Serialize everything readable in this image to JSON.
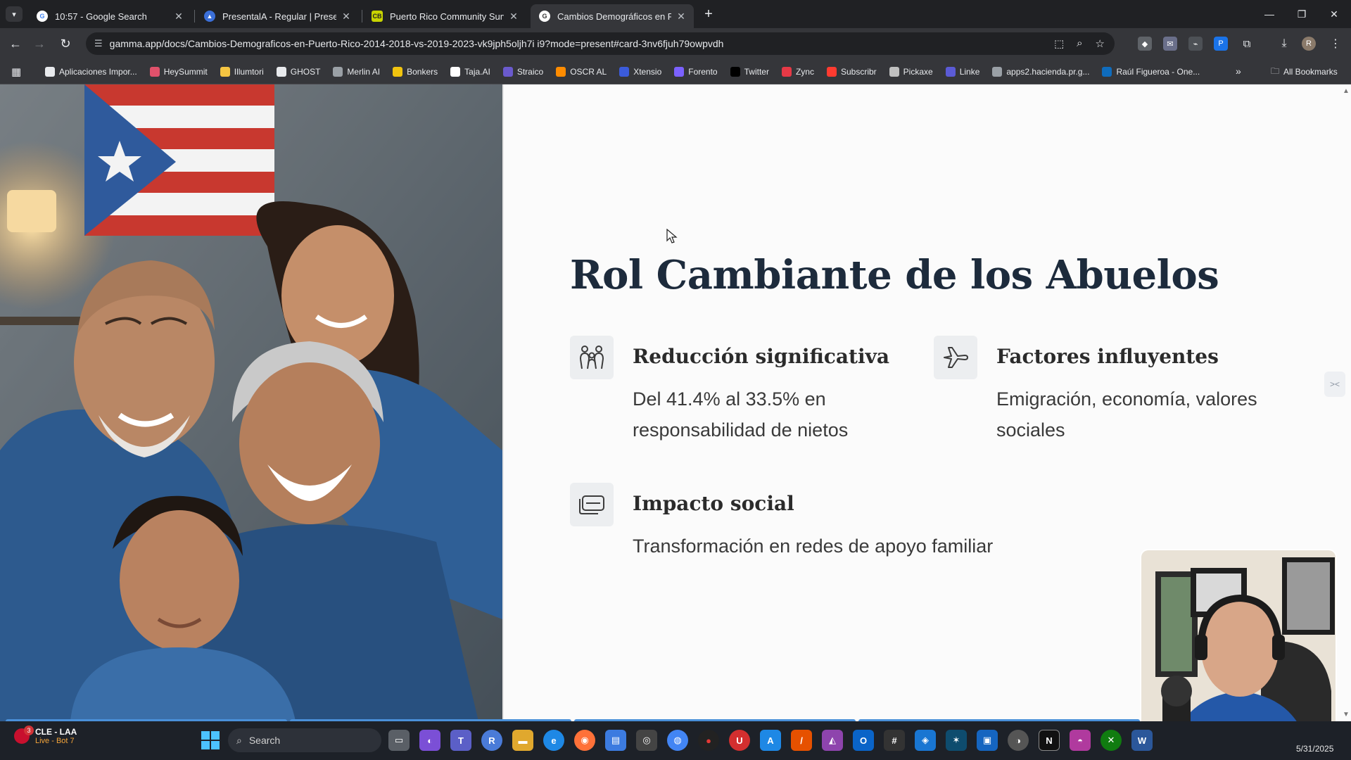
{
  "browser": {
    "tabs": [
      {
        "title": "10:57 - Google Search",
        "favicon": "google-icon",
        "active": false
      },
      {
        "title": "PresentalA - Regular | Presenta",
        "favicon": "presentala-icon",
        "active": false
      },
      {
        "title": "Puerto Rico Community Survey",
        "favicon": "cb-icon",
        "active": false
      },
      {
        "title": "Cambios Demográficos en Puer",
        "favicon": "gamma-icon",
        "active": true
      }
    ],
    "url": "gamma.app/docs/Cambios-Demograficos-en-Puerto-Rico-2014-2018-vs-2019-2023-vk9jph5oljh7i i9?mode=present#card-3nv6fjuh79owpvdh",
    "bookmarks": [
      {
        "label": "Aplicaciones Impor...",
        "icon": "folder-icon",
        "color": "#e8eaed"
      },
      {
        "label": "HeySummit",
        "icon": "heysummit-icon",
        "color": "#e0516b"
      },
      {
        "label": "Illumtori",
        "icon": "star-icon",
        "color": "#f5c542"
      },
      {
        "label": "GHOST",
        "icon": "ghost-icon",
        "color": "#e8eaed"
      },
      {
        "label": "Merlin AI",
        "icon": "merlin-icon",
        "color": "#9aa0a6"
      },
      {
        "label": "Bonkers",
        "icon": "bonkers-icon",
        "color": "#f1c40f"
      },
      {
        "label": "Taja.AI",
        "icon": "taja-icon",
        "color": "#ffffff"
      },
      {
        "label": "Straico",
        "icon": "straico-icon",
        "color": "#6a5acd"
      },
      {
        "label": "OSCR AL",
        "icon": "oscr-icon",
        "color": "#ff8c00"
      },
      {
        "label": "Xtensio",
        "icon": "xtensio-icon",
        "color": "#3b5bdb"
      },
      {
        "label": "Forento",
        "icon": "forento-icon",
        "color": "#7b61ff"
      },
      {
        "label": "Twitter",
        "icon": "x-icon",
        "color": "#000000"
      },
      {
        "label": "Zync",
        "icon": "zync-icon",
        "color": "#e63946"
      },
      {
        "label": "Subscribr",
        "icon": "subscribr-icon",
        "color": "#ff3b30"
      },
      {
        "label": "Pickaxe",
        "icon": "pickaxe-icon",
        "color": "#c0c0c0"
      },
      {
        "label": "Linke",
        "icon": "linke-icon",
        "color": "#5b5bd6"
      },
      {
        "label": "apps2.hacienda.pr.g...",
        "icon": "globe-icon",
        "color": "#9aa0a6"
      },
      {
        "label": "Raúl Figueroa - One...",
        "icon": "onedrive-icon",
        "color": "#0f6cbd"
      }
    ],
    "all_bookmarks": "All Bookmarks"
  },
  "slide": {
    "title": "Rol Cambiante de los Abuelos",
    "features": [
      {
        "heading": "Reducción significativa",
        "text": "Del 41.4% al 33.5% en responsabilidad de nietos",
        "icon": "family-icon"
      },
      {
        "heading": "Factores influyentes",
        "text": "Emigración, economía, valores sociales",
        "icon": "airplane-icon"
      },
      {
        "heading": "Impacto social",
        "text": "Transformación en redes de apoyo familiar",
        "icon": "network-icon"
      }
    ],
    "progress": {
      "segments": 4,
      "completed": 4
    }
  },
  "taskbar": {
    "weather_title": "CLE - LAA",
    "weather_sub": "Live - Bot 7",
    "notification_count": "3",
    "search_placeholder": "Search",
    "date": "5/31/2025"
  },
  "colors": {
    "title": "#1d2b3c",
    "accent_progress": "#4a90d9",
    "browser_dark": "#202124"
  }
}
